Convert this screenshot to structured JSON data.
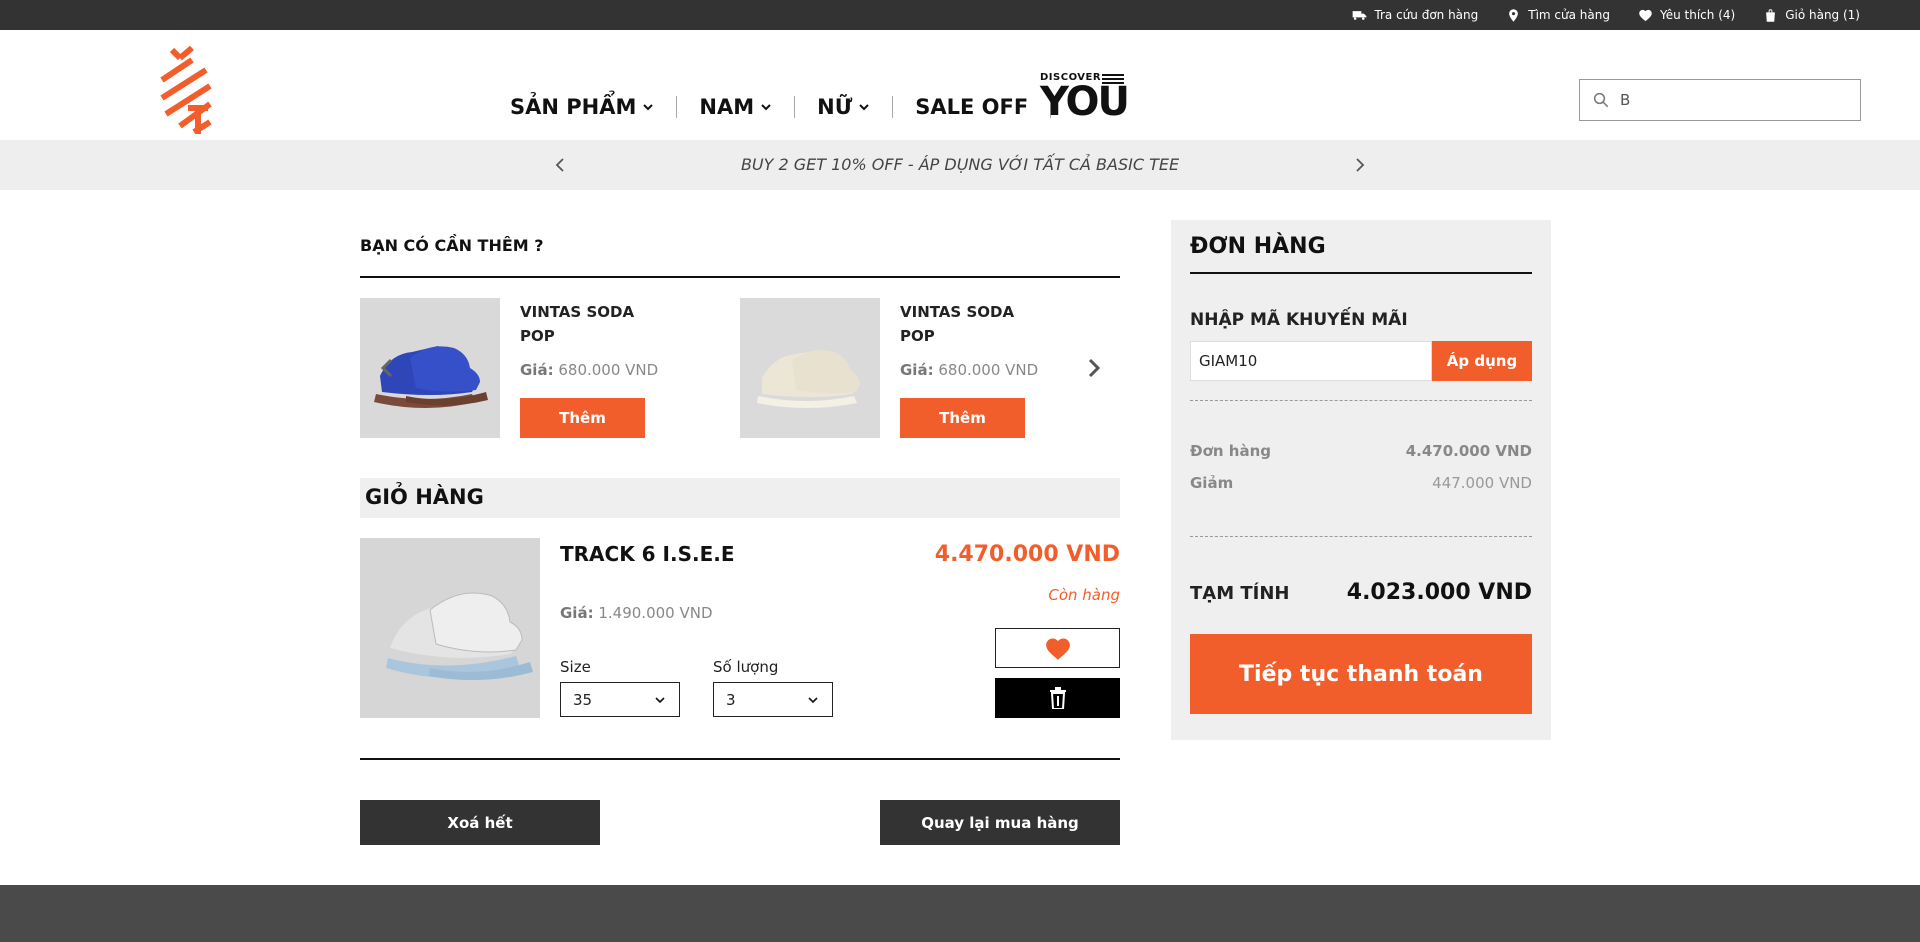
{
  "topbar": {
    "track_order": "Tra cứu đơn hàng",
    "find_store": "Tìm cửa hàng",
    "wishlist": "Yêu thích (4)",
    "cart": "Giỏ hàng (1)"
  },
  "nav": {
    "products": "SẢN PHẨM",
    "men": "NAM",
    "women": "NỮ",
    "sale": "SALE OFF"
  },
  "discover": {
    "small": "DISCOVER",
    "big": "YOU"
  },
  "search": {
    "value": "B"
  },
  "promo_bar": {
    "text": "BUY 2 GET 10% OFF - ÁP DỤNG VỚI TẤT CẢ BASIC TEE"
  },
  "upsell": {
    "title": "BẠN CÓ CẦN THÊM ?",
    "price_label": "Giá:",
    "items": [
      {
        "name": "VINTAS SODA POP",
        "price": "680.000 VND",
        "button": "Thêm",
        "color": "#2e46b8"
      },
      {
        "name": "VINTAS SODA POP",
        "price": "680.000 VND",
        "button": "Thêm",
        "color": "#ece6d6"
      }
    ]
  },
  "cart": {
    "title": "GIỎ HÀNG",
    "item": {
      "name": "TRACK 6 I.S.E.E",
      "price_label": "Giá:",
      "price": "1.490.000 VND",
      "total": "4.470.000 VND",
      "stock": "Còn hàng",
      "size_label": "Size",
      "size": "35",
      "qty_label": "Số lượng",
      "qty": "3"
    },
    "clear_button": "Xoá hết",
    "back_button": "Quay lại mua hàng"
  },
  "order": {
    "title": "ĐƠN HÀNG",
    "promo_label": "NHẬP MÃ KHUYẾN MÃI",
    "promo_value": "GIAM10",
    "apply_button": "Áp dụng",
    "subtotal_label": "Đơn hàng",
    "subtotal": "4.470.000 VND",
    "discount_label": "Giảm",
    "discount": "447.000 VND",
    "total_label": "TẠM TÍNH",
    "total": "4.023.000 VND",
    "checkout_button": "Tiếp tục thanh toán"
  },
  "colors": {
    "accent": "#f15e2c",
    "dark": "#333333",
    "panel": "#efefef"
  }
}
